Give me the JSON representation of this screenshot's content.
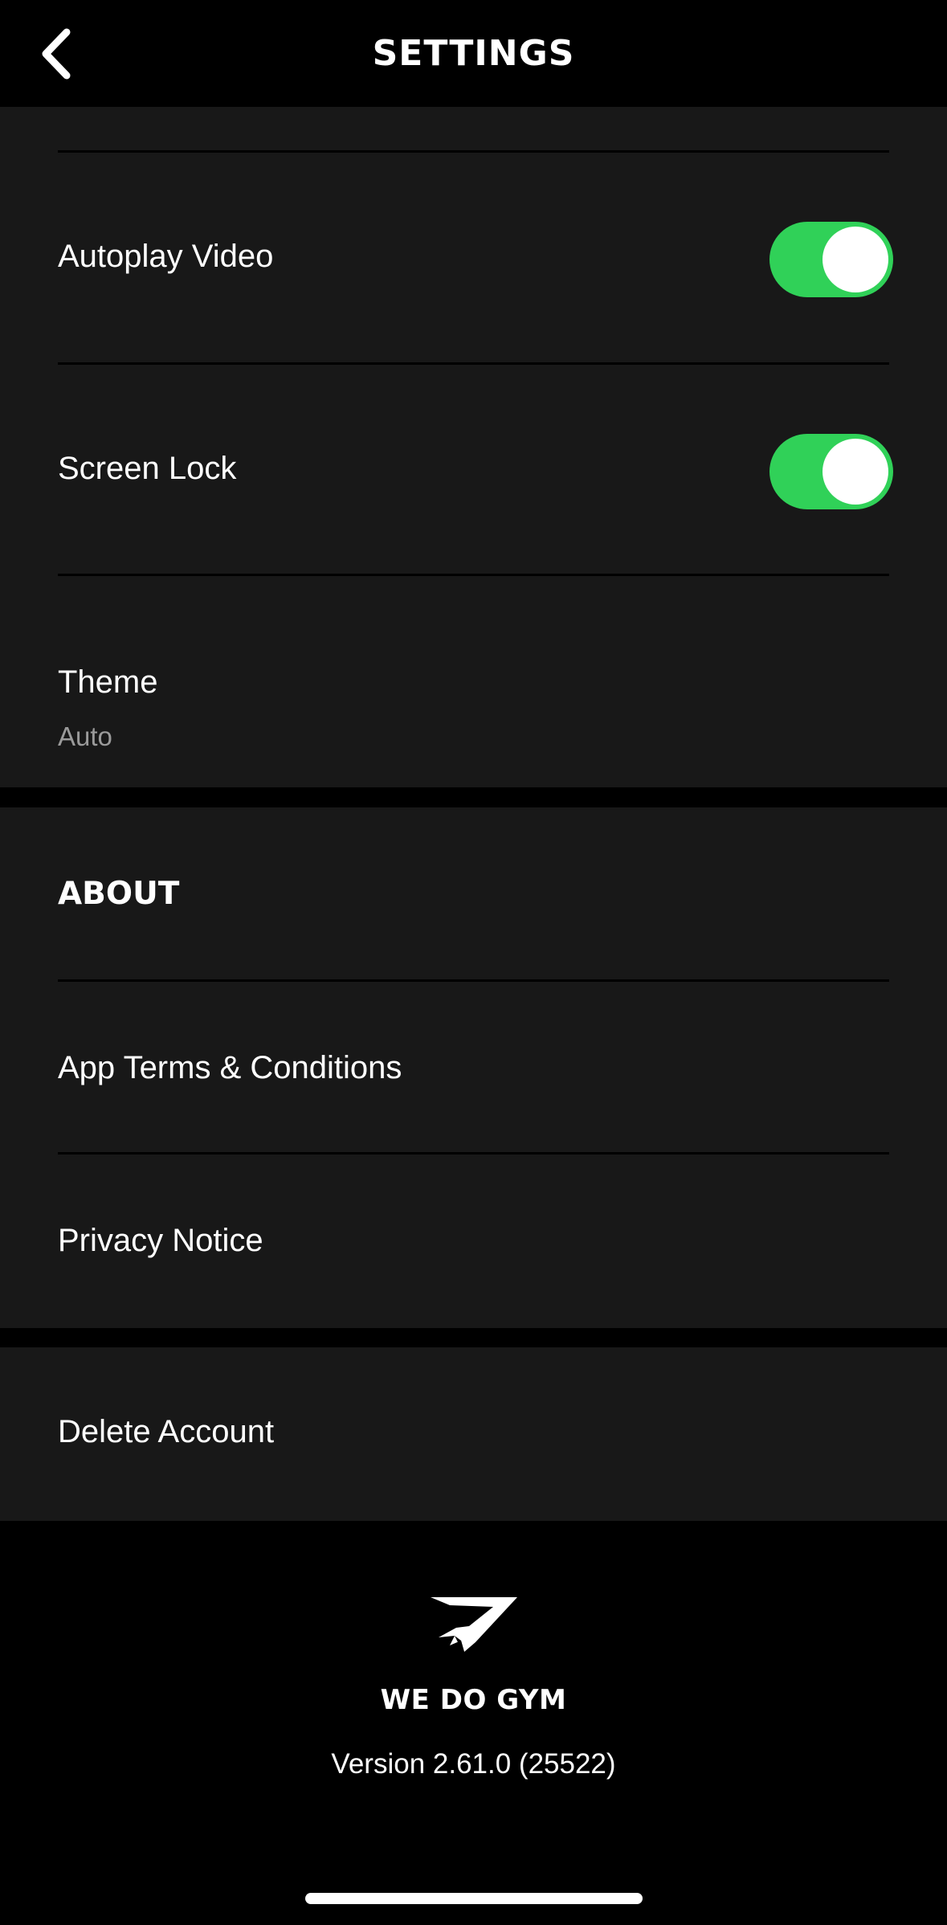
{
  "header": {
    "title": "SETTINGS",
    "back_icon": "chevron-left-icon"
  },
  "preferences": {
    "autoplay_video": {
      "label": "Autoplay Video",
      "enabled": true
    },
    "screen_lock": {
      "label": "Screen Lock",
      "enabled": true
    },
    "theme": {
      "label": "Theme",
      "value": "Auto"
    }
  },
  "about": {
    "heading": "ABOUT",
    "items": [
      {
        "label": "App Terms & Conditions"
      },
      {
        "label": "Privacy Notice"
      }
    ]
  },
  "account": {
    "delete_label": "Delete Account"
  },
  "footer": {
    "logo_icon": "gymshark-logo-icon",
    "brand": "WE DO GYM",
    "version": "Version 2.61.0 (25522)"
  },
  "colors": {
    "background": "#000000",
    "panel": "#181818",
    "toggle_on": "#30d158",
    "secondary_text": "#9a9a9a"
  }
}
